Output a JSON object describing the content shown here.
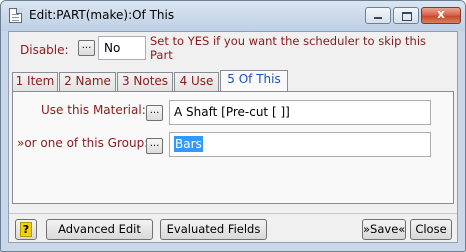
{
  "window": {
    "title": "Edit:PART(make):Of This",
    "close_glyph": "x"
  },
  "disable": {
    "label": "Disable:",
    "button": "...",
    "value": "No",
    "help_text": "Set to YES if you want the scheduler to skip this Part"
  },
  "tabs": [
    {
      "label": "1 Item",
      "active": false
    },
    {
      "label": "2 Name",
      "active": false
    },
    {
      "label": "3 Notes",
      "active": false
    },
    {
      "label": "4 Use",
      "active": false
    },
    {
      "label": "5 Of This",
      "active": true
    }
  ],
  "of_this": {
    "material_label": "Use this Material:",
    "material_button": "...",
    "material_value": "A Shaft [Pre-cut [ ]]",
    "group_label": "»or one of this Group:",
    "group_button": "...",
    "group_value": "Bars"
  },
  "footer": {
    "help_label": "?",
    "advanced_edit": "Advanced Edit",
    "evaluated_fields": "Evaluated Fields",
    "save": "»Save«",
    "close": "Close"
  }
}
